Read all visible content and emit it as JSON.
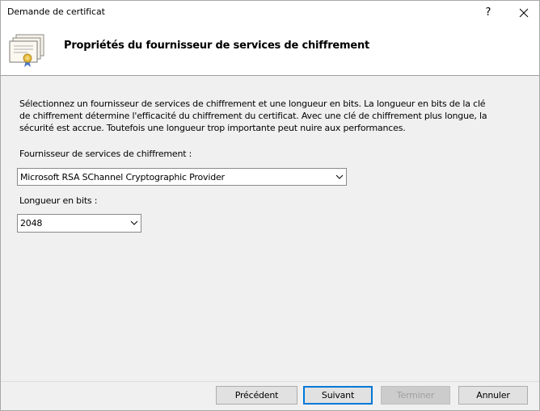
{
  "window": {
    "title": "Demande de certificat",
    "help_label": "?"
  },
  "header": {
    "icon": "certificates-icon",
    "title": "Propriétés du fournisseur de services de chiffrement"
  },
  "content": {
    "description": "Sélectionnez un fournisseur de services de chiffrement et une longueur en bits. La longueur en bits de la clé de chiffrement détermine l'efficacité du chiffrement du certificat. Avec une clé de chiffrement plus longue, la sécurité est accrue. Toutefois une longueur trop importante peut nuire aux performances.",
    "provider_label": "Fournisseur de services de chiffrement :",
    "provider_value": "Microsoft RSA SChannel Cryptographic Provider",
    "bits_label": "Longueur en bits :",
    "bits_value": "2048"
  },
  "footer": {
    "previous_label": "Précédent",
    "next_label": "Suivant",
    "finish_label": "Terminer",
    "cancel_label": "Annuler"
  },
  "colors": {
    "content_bg": "#f0f0f0",
    "accent": "#0078d7",
    "disabled_text": "#a0a0a0"
  }
}
